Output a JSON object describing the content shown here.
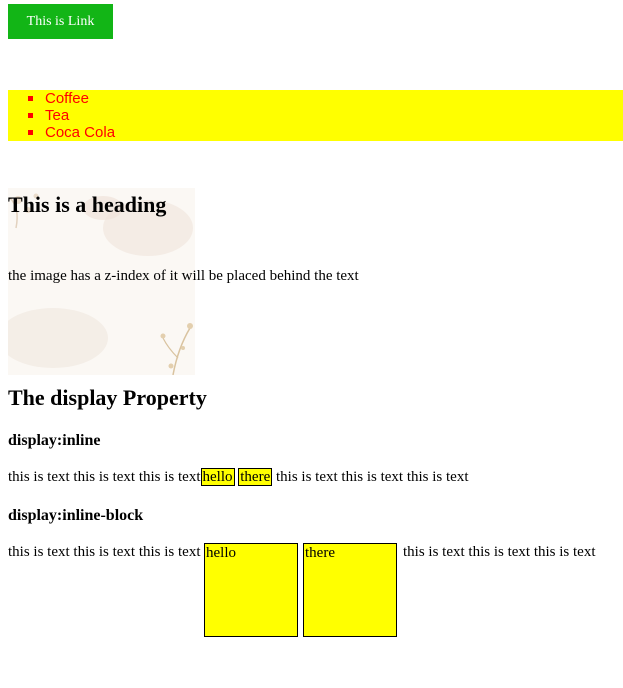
{
  "link": {
    "label": "This is Link"
  },
  "drinks": [
    "Coffee",
    "Tea",
    "Coca Cola"
  ],
  "zindex": {
    "heading": "This is a heading",
    "text": "the image has a z-index of it will be placed behind the text"
  },
  "display": {
    "title": "The display Property",
    "inline": {
      "heading": "display:inline",
      "before": "this is text this is text this is text",
      "box1": "hello",
      "box2": "there",
      "after": "this is text this is text this is text"
    },
    "inline_block": {
      "heading": "display:inline-block",
      "before": "this is text this is text this is text",
      "box1": "hello",
      "box2": "there",
      "after": "this is text this is text this is text"
    }
  },
  "colors": {
    "link_bg": "#12b516",
    "highlight": "#ffff00",
    "list_text": "#ff0000"
  }
}
